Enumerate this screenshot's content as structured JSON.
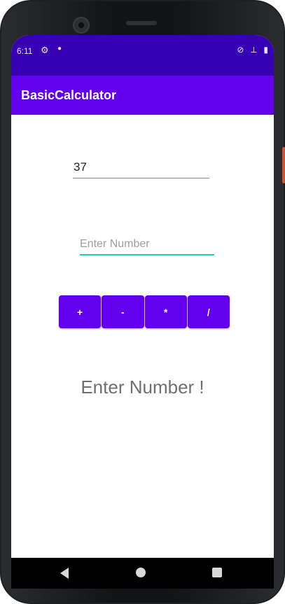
{
  "status_bar": {
    "time": "6:11",
    "icons": [
      "gear-icon",
      "dot-icon",
      "no-signal-icon",
      "wifi-icon",
      "battery-icon"
    ]
  },
  "app_bar": {
    "title": "BasicCalculator"
  },
  "form": {
    "first_input_value": "37",
    "second_input_placeholder": "Enter Number"
  },
  "operators": {
    "plus": "+",
    "minus": "-",
    "multiply": "*",
    "divide": "/"
  },
  "result": {
    "text": "Enter Number !"
  },
  "colors": {
    "status_bar": "#3700b3",
    "app_bar": "#6200ee",
    "button": "#6200ee",
    "focus_underline": "#1ed2b5"
  }
}
